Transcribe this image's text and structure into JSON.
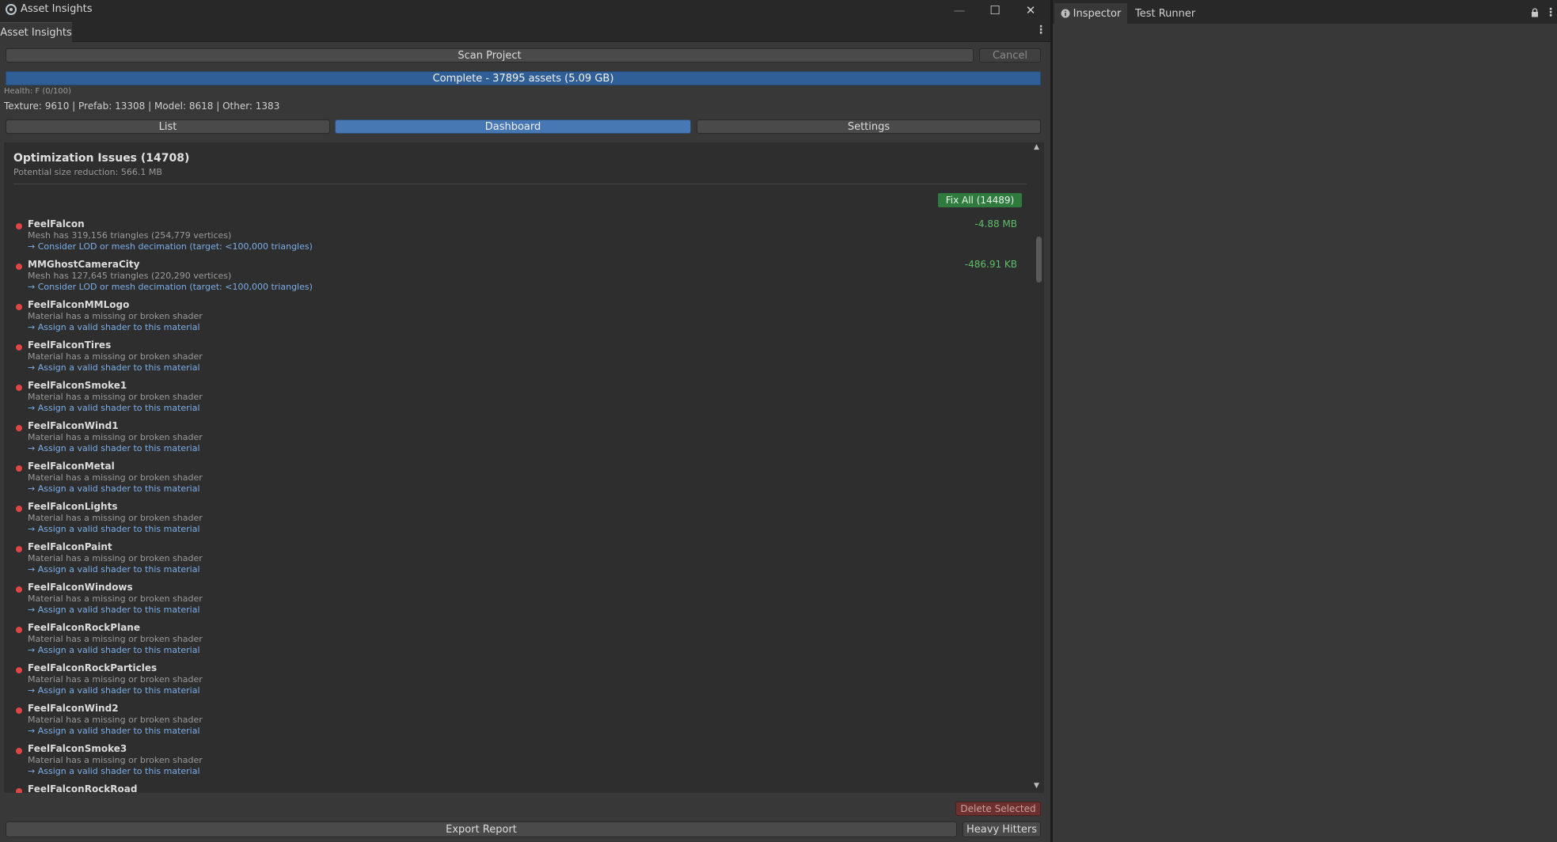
{
  "window": {
    "title": "Asset Insights",
    "tab": "Asset Insights",
    "minimize_glyph": "—",
    "maximize_glyph": "☐",
    "close_glyph": "✕"
  },
  "toolbar": {
    "scan_label": "Scan Project",
    "cancel_label": "Cancel"
  },
  "progress": {
    "text": "Complete - 37895 assets (5.09 GB)",
    "fraction": 1.0,
    "color": "#2f5f96"
  },
  "health": "Health: F (0/100)",
  "type_summary": "Texture: 9610 | Prefab: 13308 | Model: 8618 | Other: 1383",
  "tabs": [
    {
      "label": "List",
      "active": false
    },
    {
      "label": "Dashboard",
      "active": true
    },
    {
      "label": "Settings",
      "active": false
    }
  ],
  "optimization": {
    "title": "Optimization Issues (14708)",
    "subtitle": "Potential size reduction: 566.1 MB",
    "fix_all_label": "Fix All (14489)",
    "issues": [
      {
        "name": "FeelFalcon",
        "desc": "Mesh has 319,156 triangles (254,779 vertices)",
        "suggestion": "→ Consider LOD or mesh decimation (target: <100,000 triangles)",
        "saving": "-4.88 MB"
      },
      {
        "name": "MMGhostCameraCity",
        "desc": "Mesh has 127,645 triangles (220,290 vertices)",
        "suggestion": "→ Consider LOD or mesh decimation (target: <100,000 triangles)",
        "saving": "-486.91 KB"
      },
      {
        "name": "FeelFalconMMLogo",
        "desc": "Material has a missing or broken shader",
        "suggestion": "→ Assign a valid shader to this material",
        "saving": ""
      },
      {
        "name": "FeelFalconTires",
        "desc": "Material has a missing or broken shader",
        "suggestion": "→ Assign a valid shader to this material",
        "saving": ""
      },
      {
        "name": "FeelFalconSmoke1",
        "desc": "Material has a missing or broken shader",
        "suggestion": "→ Assign a valid shader to this material",
        "saving": ""
      },
      {
        "name": "FeelFalconWind1",
        "desc": "Material has a missing or broken shader",
        "suggestion": "→ Assign a valid shader to this material",
        "saving": ""
      },
      {
        "name": "FeelFalconMetal",
        "desc": "Material has a missing or broken shader",
        "suggestion": "→ Assign a valid shader to this material",
        "saving": ""
      },
      {
        "name": "FeelFalconLights",
        "desc": "Material has a missing or broken shader",
        "suggestion": "→ Assign a valid shader to this material",
        "saving": ""
      },
      {
        "name": "FeelFalconPaint",
        "desc": "Material has a missing or broken shader",
        "suggestion": "→ Assign a valid shader to this material",
        "saving": ""
      },
      {
        "name": "FeelFalconWindows",
        "desc": "Material has a missing or broken shader",
        "suggestion": "→ Assign a valid shader to this material",
        "saving": ""
      },
      {
        "name": "FeelFalconRockPlane",
        "desc": "Material has a missing or broken shader",
        "suggestion": "→ Assign a valid shader to this material",
        "saving": ""
      },
      {
        "name": "FeelFalconRockParticles",
        "desc": "Material has a missing or broken shader",
        "suggestion": "→ Assign a valid shader to this material",
        "saving": ""
      },
      {
        "name": "FeelFalconWind2",
        "desc": "Material has a missing or broken shader",
        "suggestion": "→ Assign a valid shader to this material",
        "saving": ""
      },
      {
        "name": "FeelFalconSmoke3",
        "desc": "Material has a missing or broken shader",
        "suggestion": "→ Assign a valid shader to this material",
        "saving": ""
      },
      {
        "name": "FeelFalconRockRoad",
        "desc": "",
        "suggestion": "",
        "saving": ""
      }
    ]
  },
  "footer": {
    "delete_label": "Delete Selected",
    "export_label": "Export Report",
    "heavy_label": "Heavy Hitters"
  },
  "right_dock": {
    "tabs": [
      {
        "label": "Inspector",
        "icon": "info-icon",
        "active": true
      },
      {
        "label": "Test Runner",
        "active": false
      }
    ]
  },
  "colors": {
    "accent_blue": "#4878b4",
    "severity_red": "#e04444",
    "saving_green": "#5cbf6a",
    "fix_green": "#2f7a3d",
    "link_blue": "#7aaee8"
  }
}
